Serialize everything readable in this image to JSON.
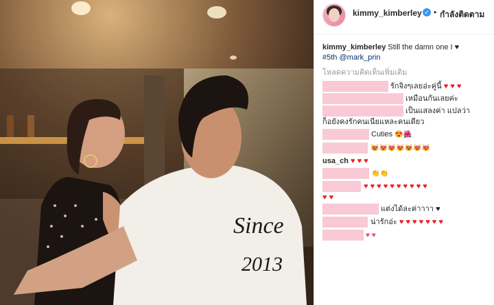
{
  "post": {
    "username": "kimmy_kimberley",
    "verified_badge": "✓",
    "separator": "•",
    "follow_label": "กำลังติดตาม",
    "caption_user": "kimmy_kimberley",
    "caption_text": "Still the damn one I ♥",
    "hashtag": "#5th",
    "mention": "@mark_prin",
    "load_more": "โหลดความคิดเห็นเพิ่มเติม",
    "shirt_text_1": "Since",
    "shirt_text_2": "2013"
  },
  "comments": [
    {
      "text": "รักจิงๆเลยอ่ะคู่นี้",
      "hearts": "♥ ♥ ♥"
    },
    {
      "text": "เหมือนกันเลยค่ะ"
    },
    {
      "text": "เป็นแสลงค่า แปลว่า"
    },
    {
      "text": "ก็อยังคงรักคนเนียแหละคนเดียว"
    },
    {
      "text": "Cuties",
      "emoji": "😍🌺"
    },
    {
      "emoji": "😻😻😻😻😻😻😻"
    },
    {
      "user": "usa_ch",
      "hearts": "♥ ♥ ♥"
    },
    {
      "emoji": "👏👏"
    },
    {
      "hearts": "♥ ♥ ♥ ♥ ♥ ♥ ♥ ♥ ♥ ♥"
    },
    {
      "hearts": "♥ ♥"
    },
    {
      "text": "แต่งได้ละค่าาาา",
      "hearts": "♥"
    },
    {
      "text": "น่ารักอ่ะ",
      "hearts": "♥ ♥ ♥ ♥ ♥ ♥ ♥"
    },
    {
      "hearts": "♥ ♥"
    }
  ],
  "colors": {
    "heart": "#ed1c24",
    "redacted": "#f9c9d6",
    "verified": "#3897f0",
    "tag": "#003569"
  }
}
